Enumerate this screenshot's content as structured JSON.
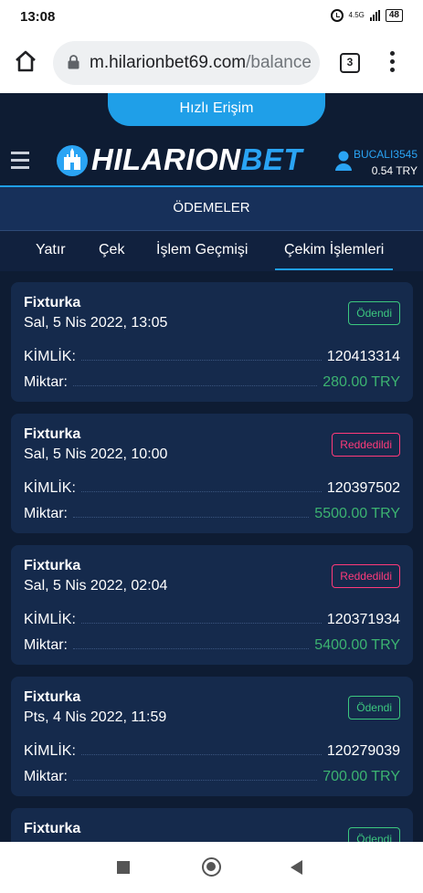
{
  "status_bar": {
    "time": "13:08",
    "network": "4.5G",
    "battery": "48"
  },
  "browser": {
    "url_host": "m.hilarionbet69.com",
    "url_path": "/balance",
    "tab_count": "3"
  },
  "site": {
    "quick_access": "Hızlı Erişim",
    "logo_part1": "HILARION",
    "logo_part2": "BET",
    "username": "BUCALI3545",
    "balance": "0.54 TRY"
  },
  "section_title": "ÖDEMELER",
  "tabs": [
    {
      "label": "Yatır"
    },
    {
      "label": "Çek"
    },
    {
      "label": "İşlem Geçmişi"
    },
    {
      "label": "Çekim İşlemleri",
      "active": true
    }
  ],
  "labels": {
    "id": "KİMLİK:",
    "amount": "Miktar:"
  },
  "withdrawals": [
    {
      "provider": "Fixturka",
      "date": "Sal, 5 Nis 2022, 13:05",
      "status": "Ödendi",
      "status_type": "paid",
      "id": "120413314",
      "amount": "280.00 TRY"
    },
    {
      "provider": "Fixturka",
      "date": "Sal, 5 Nis 2022, 10:00",
      "status": "Reddedildi",
      "status_type": "rejected",
      "id": "120397502",
      "amount": "5500.00 TRY"
    },
    {
      "provider": "Fixturka",
      "date": "Sal, 5 Nis 2022, 02:04",
      "status": "Reddedildi",
      "status_type": "rejected",
      "id": "120371934",
      "amount": "5400.00 TRY"
    },
    {
      "provider": "Fixturka",
      "date": "Pts, 4 Nis 2022, 11:59",
      "status": "Ödendi",
      "status_type": "paid",
      "id": "120279039",
      "amount": "700.00 TRY"
    },
    {
      "provider": "Fixturka",
      "date": "",
      "status": "Ödendi",
      "status_type": "paid",
      "id": "",
      "amount": ""
    }
  ],
  "colors": {
    "accent": "#1f9fe8",
    "paid": "#3cc87f",
    "rejected": "#ff3a7a",
    "amount": "#3cb371",
    "card": "#152a4c",
    "background": "#0e1c33"
  }
}
